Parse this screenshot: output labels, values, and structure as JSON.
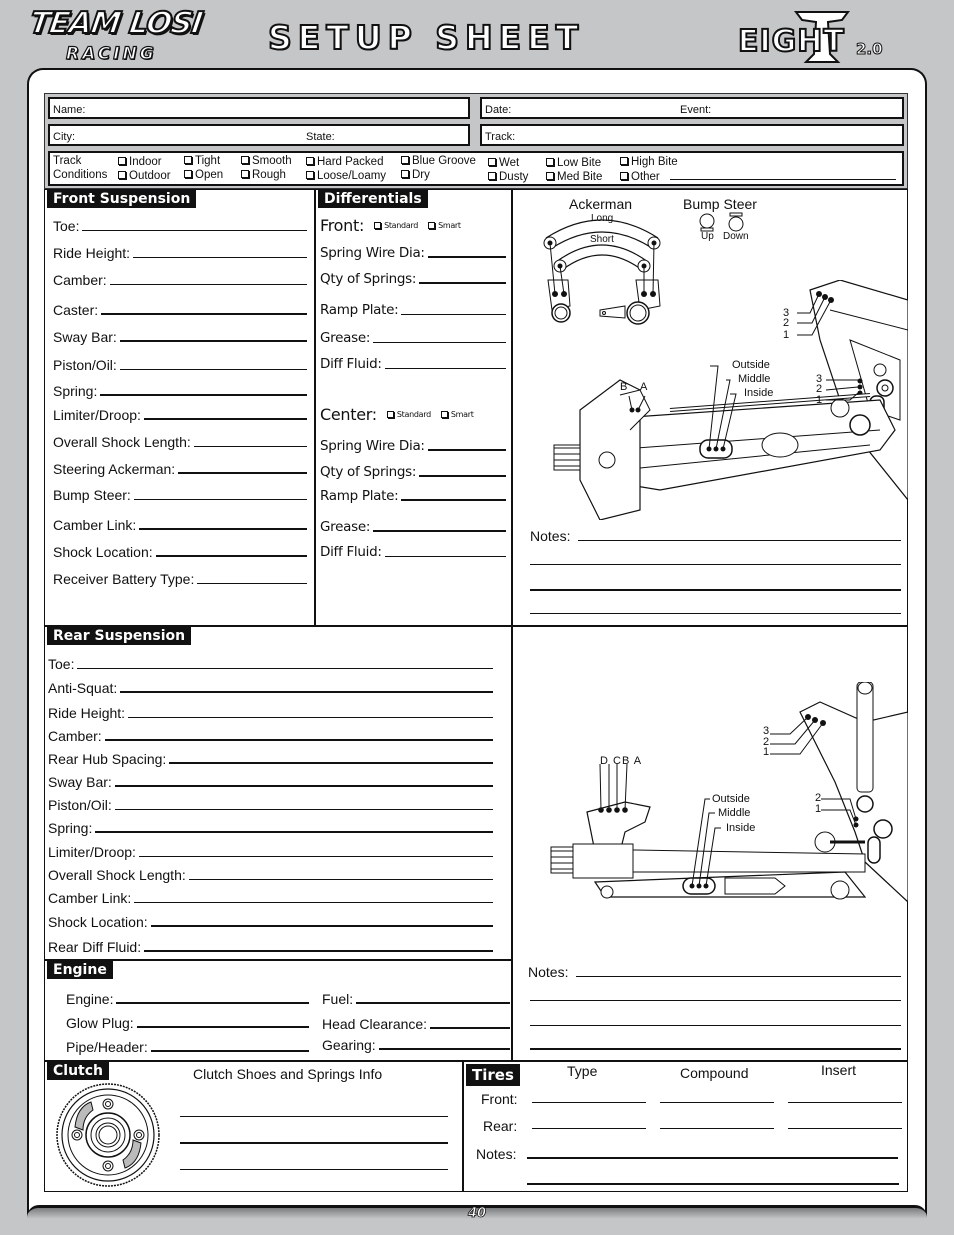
{
  "header": {
    "brand": "TEAM LOSI",
    "brand_sub": "RACING",
    "title": "SETUP SHEET",
    "model": "EIGHT",
    "model_version": "2.0"
  },
  "info": {
    "name_label": "Name:",
    "date_label": "Date:",
    "event_label": "Event:",
    "city_label": "City:",
    "state_label": "State:",
    "track_label": "Track:"
  },
  "track_conditions": {
    "label_line1": "Track",
    "label_line2": "Conditions",
    "options": [
      {
        "label": "Indoor",
        "checked": false
      },
      {
        "label": "Outdoor",
        "checked": false
      },
      {
        "label": "Tight",
        "checked": false
      },
      {
        "label": "Open",
        "checked": false
      },
      {
        "label": "Smooth",
        "checked": false
      },
      {
        "label": "Rough",
        "checked": false
      },
      {
        "label": "Hard Packed",
        "checked": false
      },
      {
        "label": "Loose/Loamy",
        "checked": false
      },
      {
        "label": "Blue Groove",
        "checked": false
      },
      {
        "label": "Dry",
        "checked": false
      },
      {
        "label": "Wet",
        "checked": false
      },
      {
        "label": "Dusty",
        "checked": false
      },
      {
        "label": "Low Bite",
        "checked": false
      },
      {
        "label": "Med Bite",
        "checked": false
      },
      {
        "label": "High Bite",
        "checked": false
      },
      {
        "label": "Other",
        "checked": false
      }
    ],
    "other_value": ""
  },
  "front_suspension": {
    "title": "Front Suspension",
    "fields": [
      {
        "label": "Toe:",
        "value": ""
      },
      {
        "label": "Ride Height:",
        "value": ""
      },
      {
        "label": "Camber:",
        "value": ""
      },
      {
        "label": "Caster:",
        "value": ""
      },
      {
        "label": "Sway Bar:",
        "value": ""
      },
      {
        "label": "Piston/Oil:",
        "value": ""
      },
      {
        "label": "Spring:",
        "value": ""
      },
      {
        "label": "Limiter/Droop:",
        "value": ""
      },
      {
        "label": "Overall Shock Length:",
        "value": ""
      },
      {
        "label": "Steering Ackerman:",
        "value": ""
      },
      {
        "label": "Bump Steer:",
        "value": ""
      },
      {
        "label": "Camber Link:",
        "value": ""
      },
      {
        "label": "Shock Location:",
        "value": ""
      },
      {
        "label": "Receiver Battery Type:",
        "value": ""
      }
    ]
  },
  "differentials": {
    "title": "Differentials",
    "front": {
      "label": "Front:",
      "options": [
        {
          "label": "Standard",
          "checked": false
        },
        {
          "label": "Smart",
          "checked": false
        }
      ],
      "fields": [
        {
          "label": "Spring Wire Dia:",
          "value": ""
        },
        {
          "label": "Qty of Springs:",
          "value": ""
        },
        {
          "label": "Ramp Plate:",
          "value": ""
        },
        {
          "label": "Grease:",
          "value": ""
        },
        {
          "label": "Diff Fluid:",
          "value": ""
        }
      ]
    },
    "center": {
      "label": "Center:",
      "options": [
        {
          "label": "Standard",
          "checked": false
        },
        {
          "label": "Smart",
          "checked": false
        }
      ],
      "fields": [
        {
          "label": "Spring Wire Dia:",
          "value": ""
        },
        {
          "label": "Qty of Springs:",
          "value": ""
        },
        {
          "label": "Ramp Plate:",
          "value": ""
        },
        {
          "label": "Grease:",
          "value": ""
        },
        {
          "label": "Diff Fluid:",
          "value": ""
        }
      ]
    }
  },
  "front_diagram": {
    "ackerman_title": "Ackerman",
    "ackerman_long": "Long",
    "ackerman_short": "Short",
    "bump_steer_title": "Bump Steer",
    "bump_up": "Up",
    "bump_down": "Down",
    "tower_holes": [
      "3",
      "2",
      "1"
    ],
    "arm_holes": [
      "3",
      "2",
      "1"
    ],
    "camber_holes": [
      "B",
      "A"
    ],
    "arm_positions": [
      "Outside",
      "Middle",
      "Inside"
    ],
    "notes_label": "Notes:"
  },
  "rear_suspension": {
    "title": "Rear Suspension",
    "fields": [
      {
        "label": "Toe:",
        "value": ""
      },
      {
        "label": "Anti-Squat:",
        "value": ""
      },
      {
        "label": "Ride Height:",
        "value": ""
      },
      {
        "label": "Camber:",
        "value": ""
      },
      {
        "label": "Rear Hub Spacing:",
        "value": ""
      },
      {
        "label": "Sway Bar:",
        "value": ""
      },
      {
        "label": "Piston/Oil:",
        "value": ""
      },
      {
        "label": "Spring:",
        "value": ""
      },
      {
        "label": "Limiter/Droop:",
        "value": ""
      },
      {
        "label": "Overall Shock Length:",
        "value": ""
      },
      {
        "label": "Camber Link:",
        "value": ""
      },
      {
        "label": "Shock Location:",
        "value": ""
      },
      {
        "label": "Rear Diff Fluid:",
        "value": ""
      }
    ]
  },
  "rear_diagram": {
    "tower_holes": [
      "3",
      "2",
      "1"
    ],
    "arm_holes": [
      "2",
      "1"
    ],
    "camber_holes": [
      "D",
      "C",
      "B",
      "A"
    ],
    "arm_positions": [
      "Outside",
      "Middle",
      "Inside"
    ],
    "notes_label": "Notes:"
  },
  "engine": {
    "title": "Engine",
    "fields": [
      {
        "label": "Engine:",
        "value": ""
      },
      {
        "label": "Fuel:",
        "value": ""
      },
      {
        "label": "Glow Plug:",
        "value": ""
      },
      {
        "label": "Head Clearance:",
        "value": ""
      },
      {
        "label": "Pipe/Header:",
        "value": ""
      },
      {
        "label": "Gearing:",
        "value": ""
      }
    ]
  },
  "clutch": {
    "title": "Clutch",
    "info_label": "Clutch Shoes and Springs Info"
  },
  "tires": {
    "title": "Tires",
    "columns": [
      "Type",
      "Compound",
      "Insert"
    ],
    "rows": [
      {
        "label": "Front:"
      },
      {
        "label": "Rear:"
      }
    ],
    "notes_label": "Notes:"
  },
  "footer": {
    "page_number": "40"
  }
}
